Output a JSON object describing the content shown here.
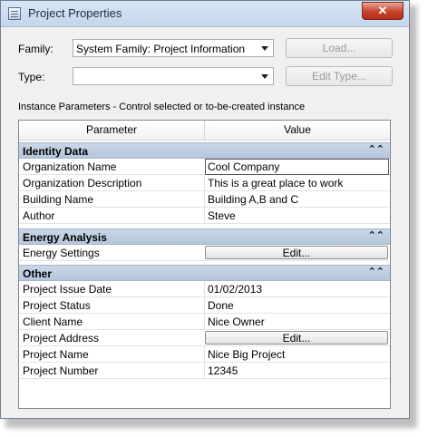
{
  "window": {
    "title": "Project Properties",
    "close_glyph": "✕"
  },
  "family": {
    "label": "Family:",
    "value": "System Family: Project Information"
  },
  "type": {
    "label": "Type:",
    "value": ""
  },
  "buttons": {
    "load": "Load...",
    "edit_type": "Edit Type..."
  },
  "instance_note": "Instance Parameters - Control selected or to-be-created instance",
  "grid": {
    "col_param": "Parameter",
    "col_value": "Value",
    "groups": [
      {
        "name": "Identity Data",
        "collapse_glyph": "⌃⌃",
        "rows": [
          {
            "param": "Organization Name",
            "value": "Cool Company"
          },
          {
            "param": "Organization Description",
            "value": "This is a great place to work"
          },
          {
            "param": "Building Name",
            "value": "Building A,B and C"
          },
          {
            "param": "Author",
            "value": "Steve"
          }
        ]
      },
      {
        "name": "Energy Analysis",
        "collapse_glyph": "⌃⌃",
        "rows": [
          {
            "param": "Energy Settings",
            "value": "Edit..."
          }
        ]
      },
      {
        "name": "Other",
        "collapse_glyph": "⌃⌃",
        "rows": [
          {
            "param": "Project Issue Date",
            "value": "01/02/2013"
          },
          {
            "param": "Project Status",
            "value": "Done"
          },
          {
            "param": "Client Name",
            "value": "Nice Owner"
          },
          {
            "param": "Project Address",
            "value": "Edit..."
          },
          {
            "param": "Project Name",
            "value": "Nice Big Project"
          },
          {
            "param": "Project Number",
            "value": "12345"
          }
        ]
      }
    ]
  }
}
